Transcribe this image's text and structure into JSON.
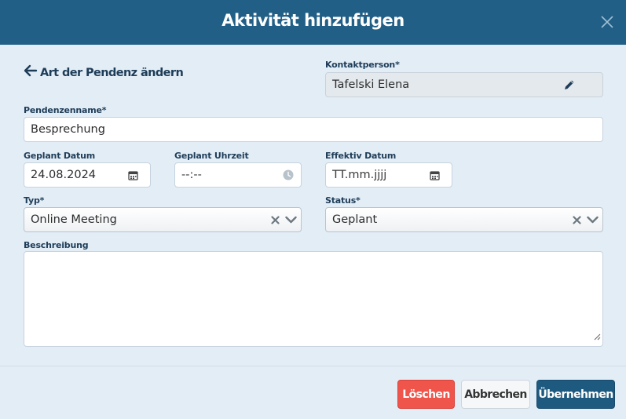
{
  "dialog": {
    "title": "Aktivität hinzufügen",
    "close_icon": "close-icon"
  },
  "back_link": {
    "label": "Art der Pendenz ändern",
    "icon": "arrow-left-icon"
  },
  "contact": {
    "label": "Kontaktperson*",
    "value": "Tafelski Elena",
    "icon": "pencil-icon"
  },
  "task_name": {
    "label": "Pendenzenname*",
    "value": "Besprechung"
  },
  "planned_date": {
    "label": "Geplant Datum",
    "value": "24.08.2024",
    "icon": "calendar-icon"
  },
  "planned_time": {
    "label": "Geplant Uhrzeit",
    "value": "--:--",
    "icon": "clock-icon"
  },
  "effective_date": {
    "label": "Effektiv Datum",
    "value": "TT.mm.jjjj",
    "icon": "calendar-icon"
  },
  "type": {
    "label": "Typ*",
    "value": "Online Meeting",
    "clear_icon": "clear-x-icon",
    "dropdown_icon": "chevron-down-icon"
  },
  "status": {
    "label": "Status*",
    "value": "Geplant",
    "clear_icon": "clear-x-icon",
    "dropdown_icon": "chevron-down-icon"
  },
  "description": {
    "label": "Beschreibung",
    "value": ""
  },
  "buttons": {
    "delete": "Löschen",
    "cancel": "Abbrechen",
    "apply": "Übernehmen"
  },
  "colors": {
    "header": "#215f86",
    "body": "#e3edf6",
    "delete": "#f0554c",
    "apply": "#1e5a80",
    "label": "#1e3d58"
  }
}
